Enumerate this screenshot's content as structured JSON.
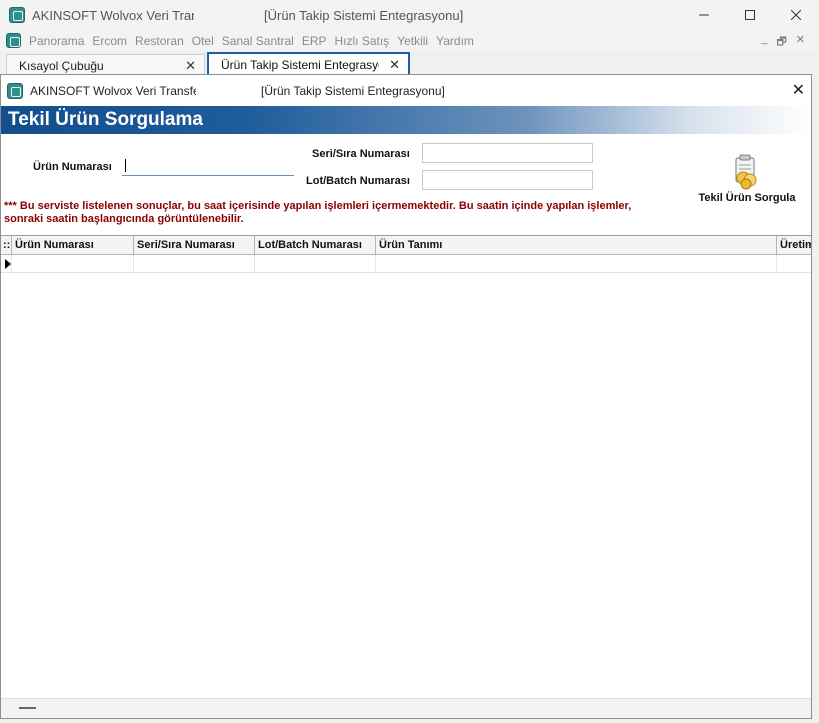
{
  "window": {
    "app_title": "AKINSOFT Wolvox Veri Transfer",
    "doc_title": "[Ürün Takip Sistemi Entegrasyonu]",
    "controls": {
      "minimize": "—",
      "maximize": "☐",
      "close": "✕"
    }
  },
  "menu": {
    "items": [
      "Panorama",
      "Ercom",
      "Restoran",
      "Otel",
      "Sanal Santral",
      "ERP",
      "Hızlı Satış",
      "Yetkili",
      "Yardım"
    ],
    "mdi_controls": {
      "minimize": "_",
      "restore": "🗗",
      "close": "✕"
    }
  },
  "tabs": [
    {
      "label": "Kısayol Çubuğu",
      "close": "✕"
    },
    {
      "label": "Ürün Takip Sistemi Entegrasyonu",
      "close": "✕"
    }
  ],
  "form": {
    "window_title": "AKINSOFT Wolvox Veri Transfer",
    "window_doc": "[Ürün Takip Sistemi Entegrasyonu]",
    "close": "✕",
    "banner": "Tekil Ürün Sorgulama",
    "urun_no_label": "Ürün Numarası",
    "urun_no_value": "",
    "seri_label": "Seri/Sıra Numarası",
    "seri_value": "",
    "lot_label": "Lot/Batch Numarası",
    "lot_value": "",
    "query_button": "Tekil Ürün Sorgula",
    "query_icon": "document-search-icon",
    "warning": "*** Bu serviste listelenen sonuçlar, bu saat içerisinde yapılan işlemleri içermemektedir. Bu saatin içinde yapılan işlemler, sonraki saatin başlangıcında görüntülenebilir."
  },
  "grid": {
    "indicator_header": "::",
    "columns": [
      "Ürün Numarası",
      "Seri/Sıra Numarası",
      "Lot/Batch Numarası",
      "Ürün Tanımı",
      "Üretim"
    ],
    "rows": [
      [
        "",
        "",
        "",
        "",
        ""
      ]
    ]
  },
  "colors": {
    "banner_start": "#144e8c",
    "warning_text": "#8b0000",
    "active_tab_border": "#1f5fa8"
  }
}
